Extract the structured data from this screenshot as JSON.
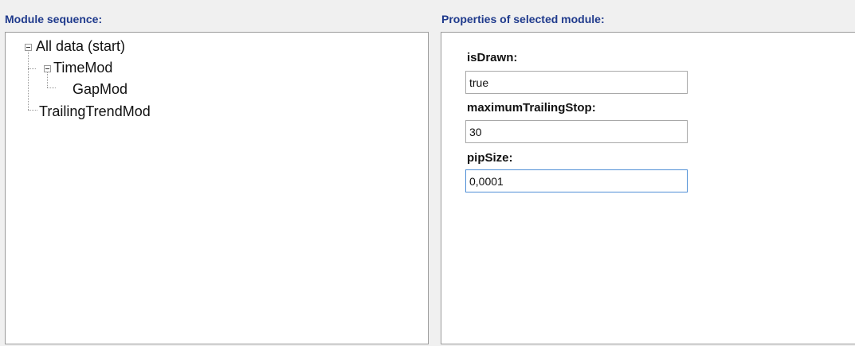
{
  "module_sequence": {
    "title": "Module sequence:",
    "tree": [
      {
        "label": "All data (start)"
      },
      {
        "label": "TimeMod"
      },
      {
        "label": "GapMod"
      },
      {
        "label": "TrailingTrendMod"
      }
    ]
  },
  "properties": {
    "title": "Properties of selected module:",
    "fields": [
      {
        "label": "isDrawn:",
        "value": "true"
      },
      {
        "label": "maximumTrailingStop:",
        "value": "30"
      },
      {
        "label": "pipSize:",
        "value": "0,0001"
      }
    ]
  },
  "colors": {
    "title": "#1f3a8c",
    "focus_border": "#4f8fd6"
  }
}
